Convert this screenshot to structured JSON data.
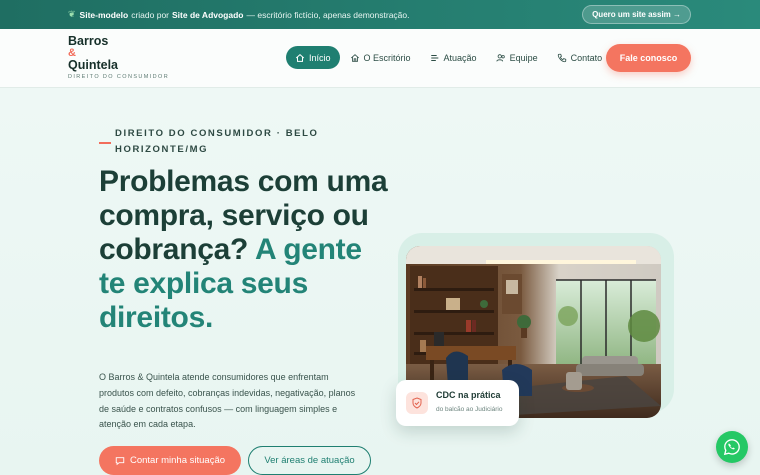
{
  "topbar": {
    "leaf_icon": "leaf-icon",
    "bold1": "Site-modelo",
    "text1": "criado por",
    "bold2": "Site de Advogado",
    "text2": "— escritório fictício, apenas demonstração.",
    "cta": "Quero um site assim →"
  },
  "logo": {
    "line1": "Barros",
    "line2": "&",
    "line3": "Quintela",
    "tagline": "DIREITO DO CONSUMIDOR"
  },
  "nav": {
    "items": [
      {
        "label": "Início",
        "icon": "home-icon",
        "active": true
      },
      {
        "label": "O Escritório",
        "icon": "building-icon",
        "active": false
      },
      {
        "label": "Atuação",
        "icon": "list-icon",
        "active": false
      },
      {
        "label": "Equipe",
        "icon": "users-icon",
        "active": false
      },
      {
        "label": "Contato",
        "icon": "phone-icon",
        "active": false
      }
    ],
    "cta": "Fale conosco"
  },
  "hero": {
    "eyebrow": "DIREITO DO CONSUMIDOR · BELO HORIZONTE/MG",
    "title_main": "Problemas com uma compra, serviço ou cobrança?",
    "title_accent": "A gente te explica seus direitos.",
    "lead": "O Barros & Quintela atende consumidores que enfrentam produtos com defeito, cobranças indevidas, negativação, planos de saúde e contratos confusos — com linguagem simples e atenção em cada etapa.",
    "primary_button": "Contar minha situação",
    "secondary_button": "Ver áreas de atuação"
  },
  "badge": {
    "title": "CDC na prática",
    "subtitle": "do balcão ao Judiciário",
    "icon": "shield-check-icon"
  },
  "floating": {
    "icon": "whatsapp-icon"
  },
  "colors": {
    "brand": "#1f7f71",
    "accent": "#f47560",
    "topbar": "#1f6e62",
    "whatsapp": "#25c865"
  }
}
